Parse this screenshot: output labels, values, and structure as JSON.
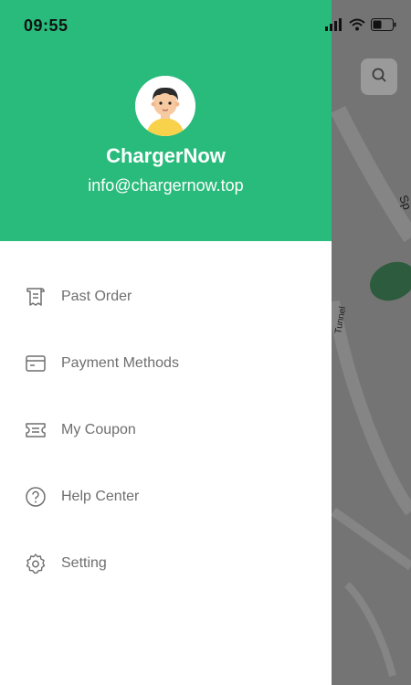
{
  "status_bar": {
    "time": "09:55",
    "icons": [
      "signal-icon",
      "wifi-icon",
      "battery-icon"
    ]
  },
  "profile": {
    "name": "ChargerNow",
    "email": "info@chargernow.top",
    "avatar_icon": "avatar-boy-icon"
  },
  "menu": {
    "items": [
      {
        "label": "Past Order",
        "icon": "receipt-icon"
      },
      {
        "label": "Payment Methods",
        "icon": "card-icon"
      },
      {
        "label": "My Coupon",
        "icon": "coupon-icon"
      },
      {
        "label": "Help Center",
        "icon": "help-icon"
      },
      {
        "label": "Setting",
        "icon": "settings-icon"
      }
    ]
  },
  "map": {
    "labels": [
      "Sp",
      "Tunnel"
    ],
    "search_icon": "search-icon"
  },
  "colors": {
    "header_green": "#29bb7b",
    "menu_text": "#6f6f6f",
    "drawer_bg": "#ffffff"
  }
}
